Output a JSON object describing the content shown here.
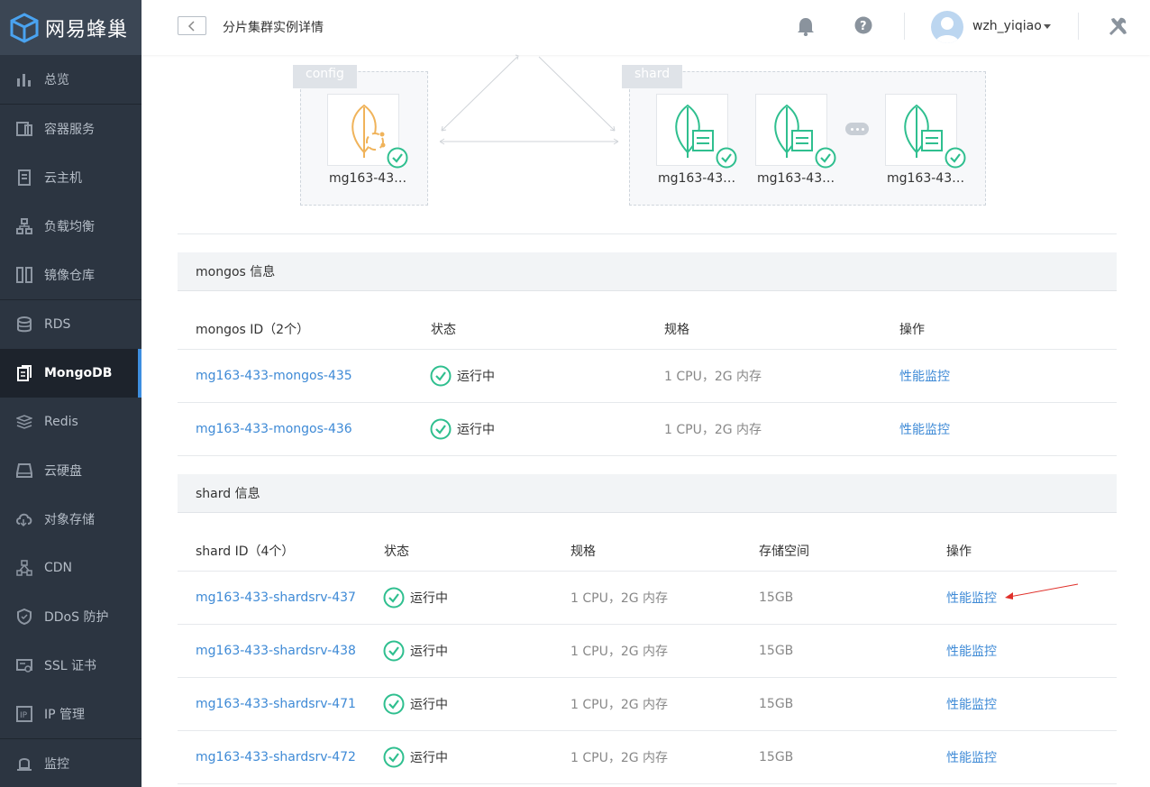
{
  "brand": {
    "name": "网易蜂巢"
  },
  "sidebar": {
    "items": [
      {
        "label": "总览",
        "icon": "bar-chart-icon"
      },
      {
        "label": "容器服务",
        "icon": "container-icon"
      },
      {
        "label": "云主机",
        "icon": "server-icon"
      },
      {
        "label": "负载均衡",
        "icon": "load-balancer-icon"
      },
      {
        "label": "镜像仓库",
        "icon": "registry-icon"
      },
      {
        "label": "RDS",
        "icon": "database-icon"
      },
      {
        "label": "MongoDB",
        "icon": "mongodb-icon"
      },
      {
        "label": "Redis",
        "icon": "redis-icon"
      },
      {
        "label": "云硬盘",
        "icon": "disk-icon"
      },
      {
        "label": "对象存储",
        "icon": "cloud-storage-icon"
      },
      {
        "label": "CDN",
        "icon": "cdn-icon"
      },
      {
        "label": "DDoS 防护",
        "icon": "shield-icon"
      },
      {
        "label": "SSL 证书",
        "icon": "certificate-icon"
      },
      {
        "label": "IP 管理",
        "icon": "ip-icon"
      },
      {
        "label": "监控",
        "icon": "monitor-icon"
      }
    ],
    "active": "MongoDB"
  },
  "header": {
    "title": "分片集群实例详情",
    "username": "wzh_yiqiao"
  },
  "topology": {
    "config": {
      "tab": "config",
      "nodes": [
        "mg163-43…"
      ]
    },
    "shard": {
      "tab": "shard",
      "nodes": [
        "mg163-43…",
        "mg163-43…",
        "mg163-43…"
      ]
    }
  },
  "mongos": {
    "section_title": "mongos 信息",
    "columns": [
      "mongos ID（2个）",
      "状态",
      "规格",
      "操作"
    ],
    "rows": [
      {
        "id": "mg163-433-mongos-435",
        "status": "运行中",
        "spec": "1 CPU，2G 内存",
        "action": "性能监控"
      },
      {
        "id": "mg163-433-mongos-436",
        "status": "运行中",
        "spec": "1 CPU，2G 内存",
        "action": "性能监控"
      }
    ]
  },
  "shard": {
    "section_title": "shard 信息",
    "columns": [
      "shard ID（4个）",
      "状态",
      "规格",
      "存储空间",
      "操作"
    ],
    "rows": [
      {
        "id": "mg163-433-shardsrv-437",
        "status": "运行中",
        "spec": "1 CPU，2G 内存",
        "storage": "15GB",
        "action": "性能监控"
      },
      {
        "id": "mg163-433-shardsrv-438",
        "status": "运行中",
        "spec": "1 CPU，2G 内存",
        "storage": "15GB",
        "action": "性能监控"
      },
      {
        "id": "mg163-433-shardsrv-471",
        "status": "运行中",
        "spec": "1 CPU，2G 内存",
        "storage": "15GB",
        "action": "性能监控"
      },
      {
        "id": "mg163-433-shardsrv-472",
        "status": "运行中",
        "spec": "1 CPU，2G 内存",
        "storage": "15GB",
        "action": "性能监控"
      }
    ]
  },
  "colors": {
    "accent": "#3e8ad6",
    "success": "#2fbf8f",
    "config_node": "#f0b35a",
    "sidebar_bg": "#2c3541"
  }
}
